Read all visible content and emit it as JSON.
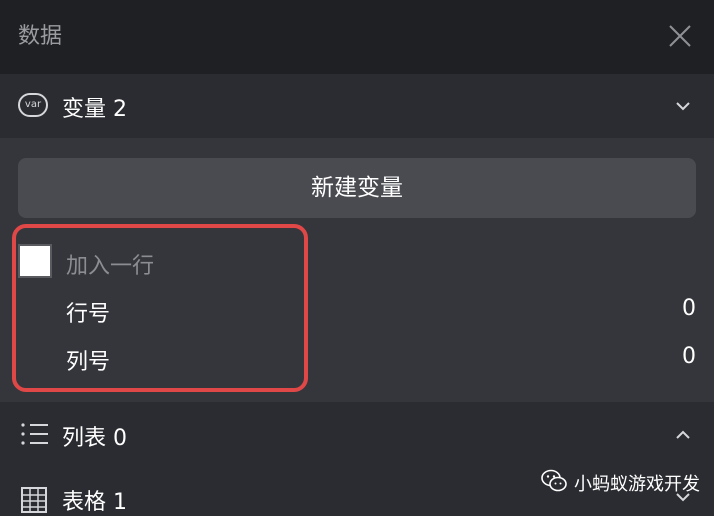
{
  "header": {
    "title": "数据"
  },
  "variables": {
    "label": "变量 2",
    "badge": "var"
  },
  "panel": {
    "new_variable_button": "新建变量",
    "add_row_label": "加入一行",
    "fields": [
      {
        "label": "行号",
        "value": "0"
      },
      {
        "label": "列号",
        "value": "0"
      }
    ]
  },
  "lists": {
    "label": "列表 0"
  },
  "tables": {
    "label": "表格 1"
  },
  "watermark": {
    "text": "小蚂蚁游戏开发"
  },
  "colors": {
    "header_bg": "#1f2024",
    "section_bg": "#2b2c31",
    "panel_bg": "#35363c",
    "button_bg": "#4a4b51",
    "highlight_border": "#e04848"
  }
}
